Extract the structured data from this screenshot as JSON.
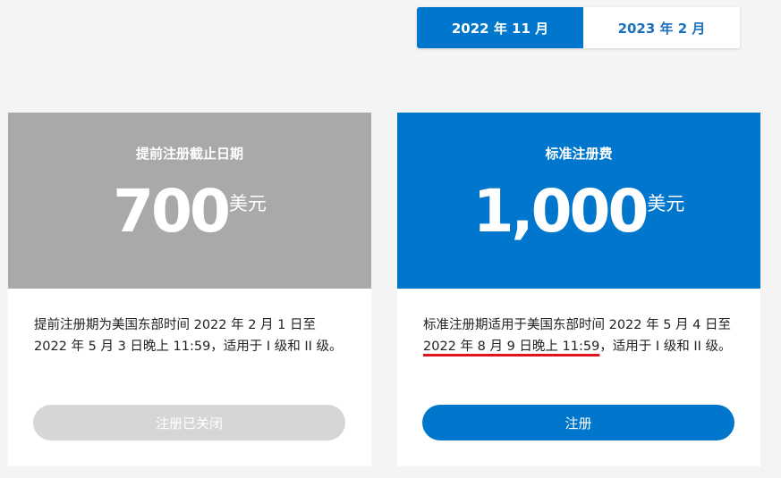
{
  "tabs": [
    {
      "label": "2022 年 11 月",
      "active": true
    },
    {
      "label": "2023 年 2 月",
      "active": false
    }
  ],
  "cards": [
    {
      "title": "提前注册截止日期",
      "price": "700",
      "unit": "美元",
      "description_parts": [
        "提前注册期为美国东部时间 2022 年 2 月 1 日至 2022 年 5 月 3 日晚上 11:59，适用于 I 级和 II 级。"
      ],
      "button_label": "注册已关闭",
      "button_state": "disabled"
    },
    {
      "title": "标准注册费",
      "price": "1,000",
      "unit": "美元",
      "description_before": "标准注册期适用于美国东部时间 2022 年 5 月 4 日至 ",
      "description_highlight": "2022 年 8 月 9 日晚上 11:59",
      "description_after": "，适用于 I 级和 II 级。",
      "button_label": "注册",
      "button_state": "enabled"
    }
  ],
  "colors": {
    "primary": "#0077cc",
    "grey_header": "#a8a9ab",
    "disabled_button": "#d5d6d8",
    "highlight_underline": "#e0141e"
  }
}
